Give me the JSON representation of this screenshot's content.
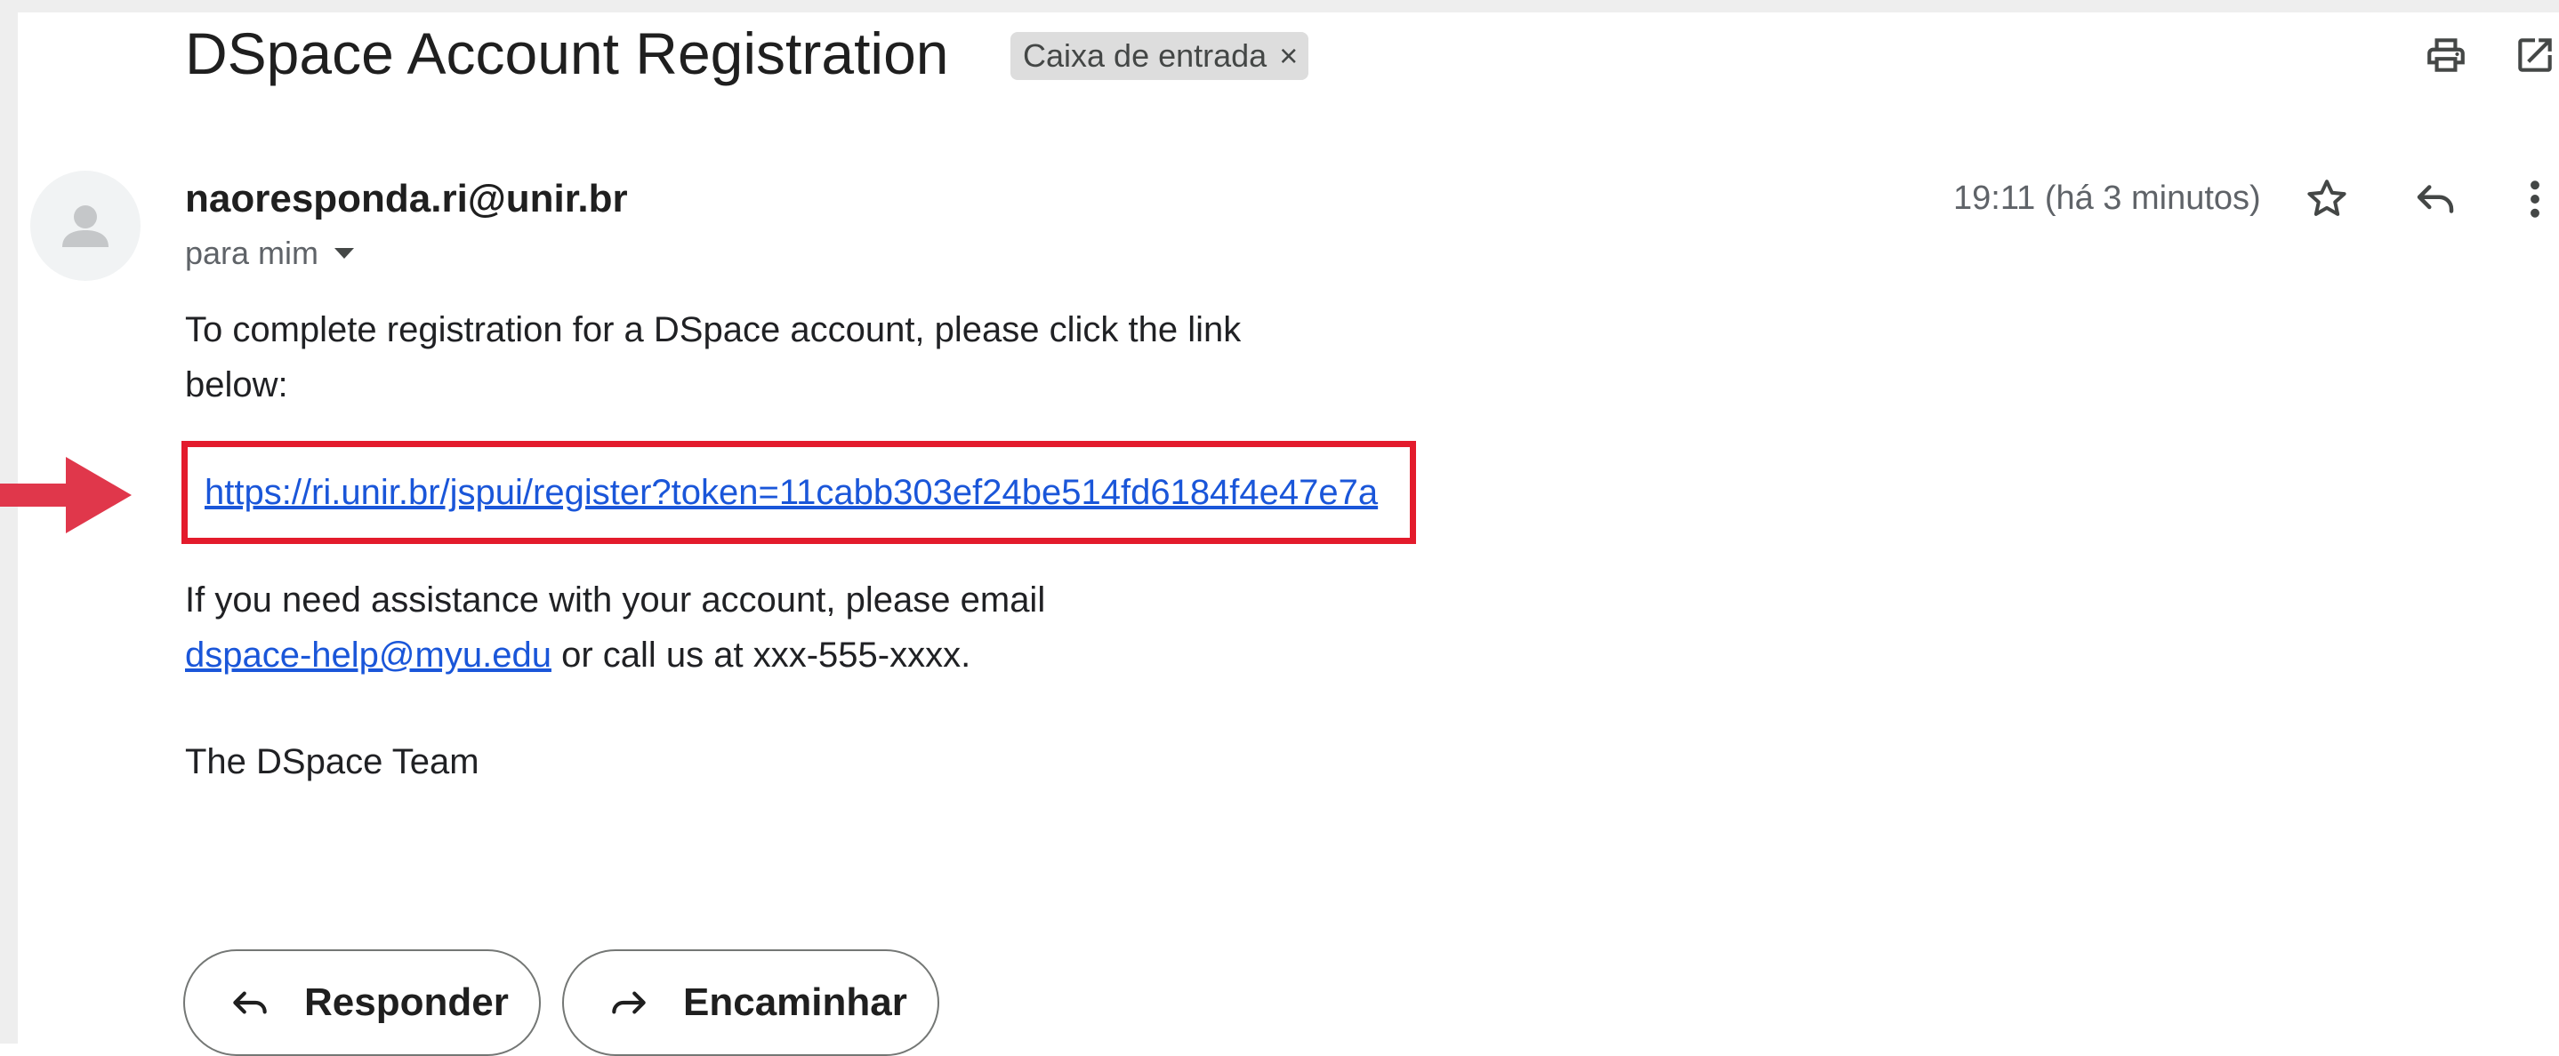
{
  "email": {
    "subject": "DSpace Account Registration",
    "label": "Caixa de entrada",
    "label_remove": "×",
    "sender": "naoresponda.ri@unir.br",
    "recipient": "para mim",
    "timestamp": "19:11 (há 3 minutos)",
    "body": {
      "intro": "To complete registration for a DSpace account, please click the link below:",
      "registration_link": "https://ri.unir.br/jspui/register?token=11cabb303ef24be514fd6184f4e47e7a",
      "assistance_before": "If you need assistance with your account, please email",
      "help_email": "dspace-help@myu.edu",
      "assistance_after": " or call us at xxx-555-xxxx.",
      "signature": "The DSpace Team"
    }
  },
  "actions": {
    "reply_label": "Responder",
    "forward_label": "Encaminhar"
  },
  "icons": [
    "print-icon",
    "open-in-new-window-icon",
    "star-icon",
    "reply-icon",
    "more-options-icon",
    "avatar-person-icon",
    "annotation-arrow"
  ],
  "colors": {
    "link": "#1a56d9",
    "highlight_border": "#e31b2c",
    "annotation_arrow": "#e0374b",
    "label_chip_bg": "#dddddd"
  }
}
